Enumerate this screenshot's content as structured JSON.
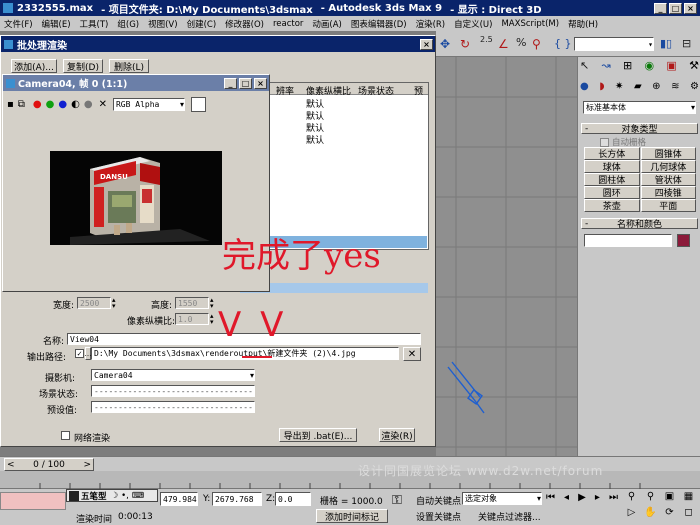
{
  "app_title": {
    "file": "2332555.max",
    "project": "- 项目文件夹: D:\\My Documents\\3dsmax",
    "app": "- Autodesk 3ds Max 9",
    "display": "- 显示 : Direct 3D"
  },
  "menu": [
    "文件(F)",
    "编辑(E)",
    "工具(T)",
    "组(G)",
    "视图(V)",
    "创建(C)",
    "修改器(O)",
    "reactor",
    "动画(A)",
    "图表编辑器(D)",
    "渲染(R)",
    "自定义(U)",
    "MAXScript(M)",
    "帮助(H)"
  ],
  "batch_dialog": {
    "title": "批处理渲染",
    "add": "添加(A)...",
    "copy": "复制(D)",
    "delete": "删除(L)",
    "columns": [
      "辨率",
      "像素纵横比",
      "场景状态",
      "预"
    ],
    "rows": [
      "默认",
      "默认",
      "默认",
      "默认"
    ],
    "width_label": "宽度:",
    "width_value": "2500",
    "height_label": "高度:",
    "height_value": "1550",
    "aspect_label": "像素纵横比:",
    "aspect_value": "1.0",
    "name_label": "名称:",
    "name_value": "View04",
    "output_label": "输出路径:",
    "output_value": "D:\\My Documents\\3dsmax\\renderoutput\\新建文件夹 (2)\\4.jpg",
    "camera_label": "摄影机:",
    "camera_value": "Camera04",
    "scene_state_label": "场景状态:",
    "preset_label": "预设值:",
    "net_render": "网络渲染",
    "export_bat": "导出到 .bat(E)...",
    "render": "渲染(R)"
  },
  "camera_window": {
    "title": "Camera04, 帧 0 (1:1)",
    "channel": "RGB Alpha"
  },
  "annotations": {
    "done": "完成了yes",
    "checks": "V V"
  },
  "command_panel": {
    "category": "标准基本体",
    "rollout_object_type": "对象类型",
    "autogrid": "自动栅格",
    "objects": [
      "长方体",
      "圆锥体",
      "球体",
      "几何球体",
      "圆柱体",
      "管状体",
      "圆环",
      "四棱锥",
      "茶壶",
      "平面"
    ],
    "rollout_name_color": "名称和颜色",
    "swatch_color": "#8b1a3a"
  },
  "timeline": {
    "frame": "0 / 100"
  },
  "watermark": "设计同国展览论坛 www.d2w.net/forum",
  "status": {
    "script_name": "五笔型",
    "x_value": "479.984",
    "y_label": "Y:",
    "y_value": "2679.768",
    "z_label": "Z:",
    "z_value": "0.0",
    "grid_label": "栅格 = 1000.0",
    "autokey": "自动关键点",
    "set_key": "设置关键点",
    "selected": "选定对象",
    "key_filters": "关键点过滤器...",
    "render_time_label": "渲染时间",
    "render_time_value": "0:00:13",
    "add_time_tag": "添加时间标记"
  },
  "colors": {
    "title_blue": "#0a246a",
    "viewport_gray": "#8f8f8f",
    "annotation_red": "#e0182a"
  }
}
